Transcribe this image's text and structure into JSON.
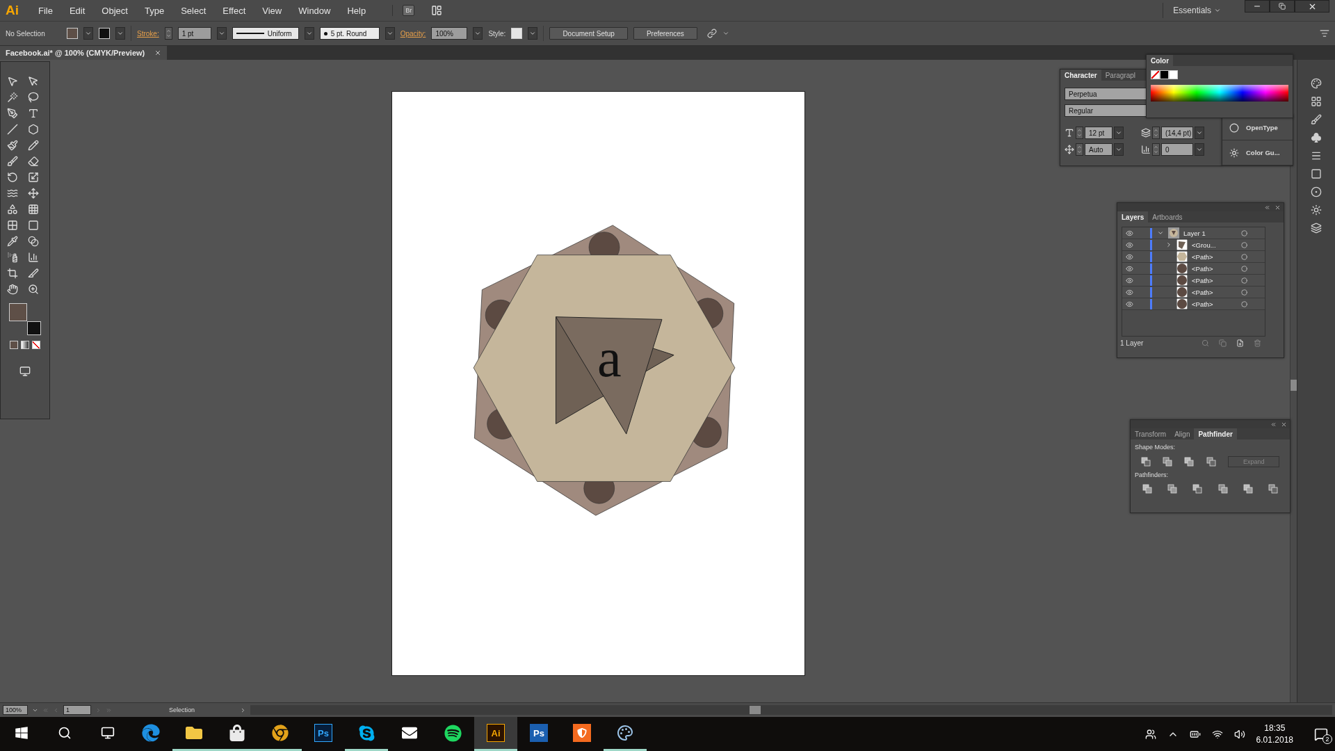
{
  "menu_bar": {
    "logo": "Ai",
    "menus": [
      "File",
      "Edit",
      "Object",
      "Type",
      "Select",
      "Effect",
      "View",
      "Window",
      "Help"
    ],
    "bridge": "Br",
    "workspace": "Essentials"
  },
  "control_bar": {
    "selection": "No Selection",
    "stroke_label": "Stroke:",
    "stroke_weight": "1 pt",
    "stroke_profile": "Uniform",
    "brush": "5 pt. Round",
    "opacity_label": "Opacity:",
    "opacity": "100%",
    "style_label": "Style:",
    "buttons": [
      "Document Setup",
      "Preferences"
    ]
  },
  "document_tab": {
    "title": "Facebook.ai* @ 100% (CMYK/Preview)"
  },
  "artwork": {
    "letter": "a"
  },
  "character_panel": {
    "tabs": [
      {
        "label": "Character",
        "selected": true
      },
      {
        "label": "Paragrapl",
        "selected": false
      }
    ],
    "font": "Perpetua",
    "style": "Regular",
    "size": "12 pt",
    "leading": "(14,4 pt)",
    "kerning": "Auto",
    "tracking": "0"
  },
  "color_panel": {
    "title": "Color"
  },
  "collapsed_panels": [
    {
      "label": "OpenType",
      "kind": "opentype"
    },
    {
      "label": "Color Gu...",
      "kind": "guide"
    }
  ],
  "layers_panel": {
    "tabs": [
      {
        "label": "Layers",
        "selected": true
      },
      {
        "label": "Artboards",
        "selected": false
      }
    ],
    "layers": [
      {
        "name": "Layer 1",
        "kind": "layer",
        "visible": true,
        "expanded": true,
        "children": [
          {
            "name": "<Grou...",
            "kind": "group",
            "visible": true,
            "expanded": false
          },
          {
            "name": "<Path>",
            "kind": "hexagon",
            "visible": true
          },
          {
            "name": "<Path>",
            "kind": "circle",
            "visible": true
          },
          {
            "name": "<Path>",
            "kind": "circle",
            "visible": true
          },
          {
            "name": "<Path>",
            "kind": "circle",
            "visible": true
          },
          {
            "name": "<Path>",
            "kind": "circle",
            "visible": true
          }
        ]
      }
    ],
    "footer": "1 Layer"
  },
  "pathfinder_panel": {
    "tabs": [
      {
        "label": "Transform",
        "selected": false
      },
      {
        "label": "Align",
        "selected": false
      },
      {
        "label": "Pathfinder",
        "selected": true
      }
    ],
    "shape_modes_label": "Shape Modes:",
    "expand": {
      "label": "Expand",
      "disabled": true
    },
    "pathfinders_label": "Pathfinders:"
  },
  "status_bar": {
    "zoom": "100%",
    "artboard": "1",
    "tool": "Selection"
  },
  "taskbar": {
    "apps": [
      {
        "kind": "edge",
        "running": false,
        "active": false
      },
      {
        "kind": "folder",
        "running": true,
        "active": false
      },
      {
        "kind": "store",
        "running": true,
        "active": false
      },
      {
        "kind": "chrome",
        "running": true,
        "active": false
      },
      {
        "kind": "ps",
        "label": "Ps",
        "running": false,
        "active": false
      },
      {
        "kind": "skype",
        "running": true,
        "active": false
      },
      {
        "kind": "mail",
        "running": false,
        "active": false
      },
      {
        "kind": "spotify",
        "running": false,
        "active": false
      },
      {
        "kind": "ai",
        "label": "Ai",
        "running": true,
        "active": true
      },
      {
        "kind": "ps2",
        "label": "Ps",
        "running": false,
        "active": false
      },
      {
        "kind": "shield",
        "running": false,
        "active": false
      },
      {
        "kind": "palette",
        "running": true,
        "active": false
      }
    ],
    "time": "18:35",
    "date": "6.01.2018",
    "notifications": "2"
  }
}
